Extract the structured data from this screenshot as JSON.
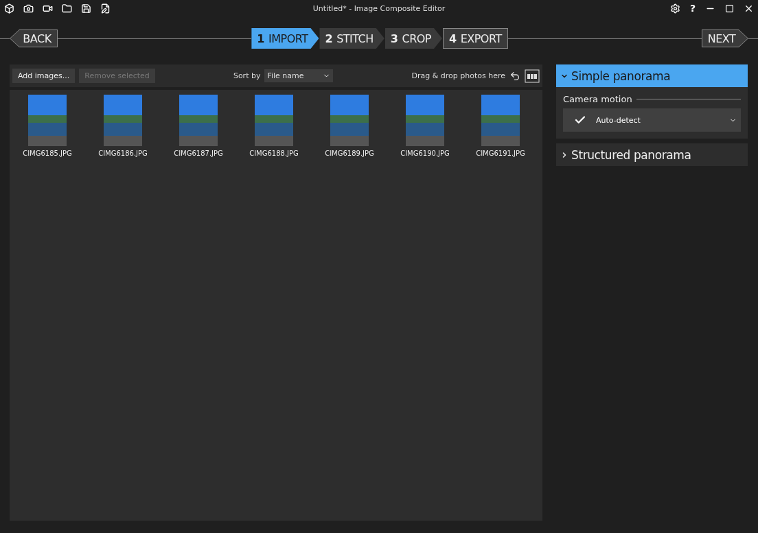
{
  "window": {
    "title": "Untitled* - Image Composite Editor",
    "help": "?"
  },
  "nav": {
    "back": "BACK",
    "next": "NEXT"
  },
  "steps": [
    {
      "number": "1",
      "label": "IMPORT",
      "selected": true
    },
    {
      "number": "2",
      "label": "STITCH",
      "selected": false
    },
    {
      "number": "3",
      "label": "CROP",
      "selected": false
    },
    {
      "number": "4",
      "label": "EXPORT",
      "selected": false
    }
  ],
  "toolbar": {
    "add": "Add images...",
    "remove": "Remove selected",
    "remove_disabled": true,
    "sort_label": "Sort by",
    "sort_value": "File name",
    "drop_hint": "Drag & drop photos here"
  },
  "images": [
    {
      "name": "CIMG6185.JPG"
    },
    {
      "name": "CIMG6186.JPG"
    },
    {
      "name": "CIMG6187.JPG"
    },
    {
      "name": "CIMG6188.JPG"
    },
    {
      "name": "CIMG6189.JPG"
    },
    {
      "name": "CIMG6190.JPG"
    },
    {
      "name": "CIMG6191.JPG"
    }
  ],
  "sections": [
    {
      "title": "Simple panorama",
      "expanded": true,
      "field_label": "Camera motion",
      "field_value": "Auto-detect"
    },
    {
      "title": "Structured panorama",
      "expanded": false
    }
  ]
}
